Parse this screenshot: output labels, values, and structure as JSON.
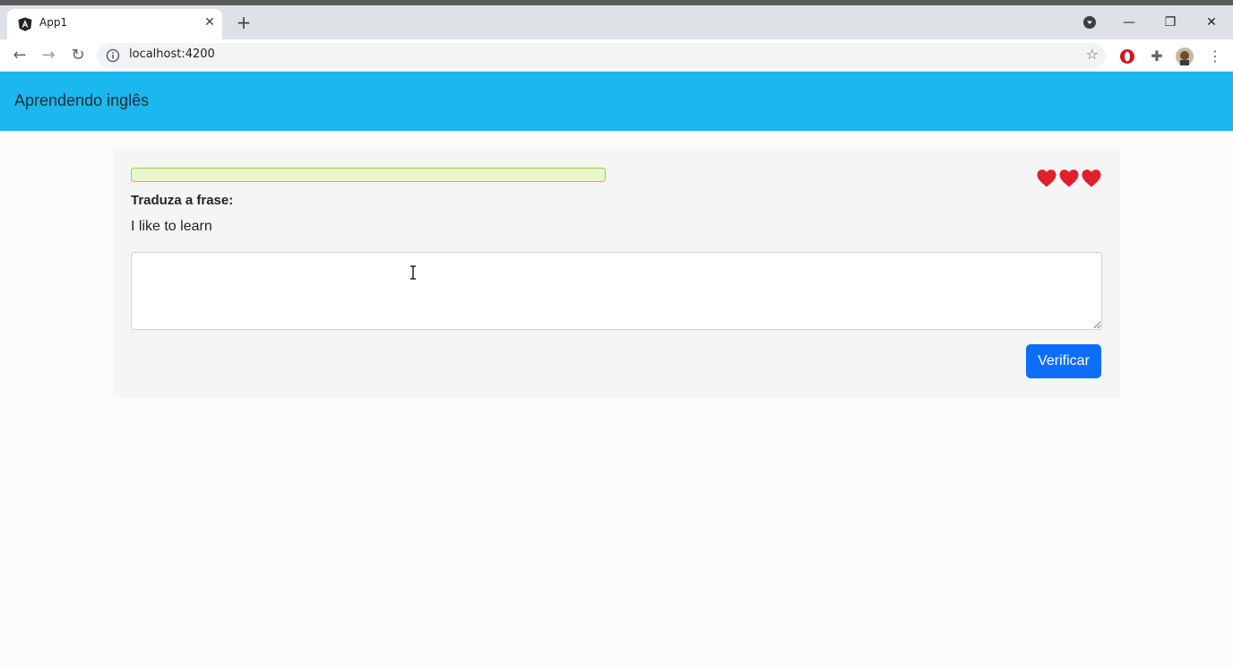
{
  "browser": {
    "tab": {
      "title": "App1",
      "icon": "angular-icon"
    },
    "url": "localhost:4200"
  },
  "app": {
    "title": "Aprendendo inglês"
  },
  "exercise": {
    "instruction": "Traduza a frase:",
    "sentence": "I like to learn",
    "answer_value": "",
    "progress_percent": 0,
    "lives": 3,
    "verify_label": "Verificar"
  },
  "colors": {
    "app_bar": "#1ab8ee",
    "primary_button": "#0d6efd",
    "heart": "#e0202a",
    "progress_border": "#8fd146"
  }
}
